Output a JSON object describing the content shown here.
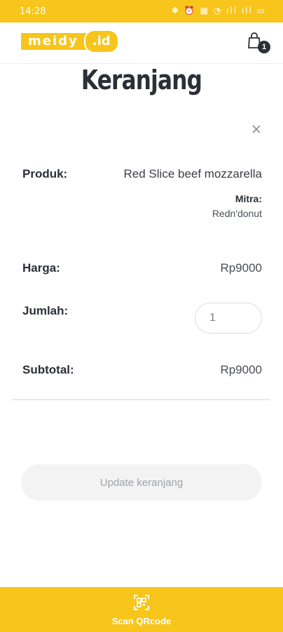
{
  "status_bar": {
    "time": "14:28",
    "icons": "✱ ⏰ ▦ ◔ ıll ıll ▭"
  },
  "header": {
    "logo_main": "meidy",
    "logo_suffix": ".id",
    "cart_count": "1",
    "icons": {
      "cart": "shopping-bag-icon"
    }
  },
  "page": {
    "title": "Keranjang"
  },
  "item": {
    "product_label": "Produk:",
    "product_name": "Red Slice beef mozzarella",
    "mitra_label": "Mitra:",
    "mitra_name": "Redn'donut",
    "price_label": "Harga:",
    "price_value": "Rp9000",
    "quantity_label": "Jumlah:",
    "quantity_value": "1",
    "subtotal_label": "Subtotal:",
    "subtotal_value": "Rp9000"
  },
  "actions": {
    "update_label": "Update keranjang"
  },
  "bottom_nav": {
    "scan_label": "Scan QRcode",
    "icon": "qr-scan-icon"
  },
  "colors": {
    "accent": "#f7c51b",
    "text": "#2b2f36",
    "muted": "#9ea2a8"
  }
}
